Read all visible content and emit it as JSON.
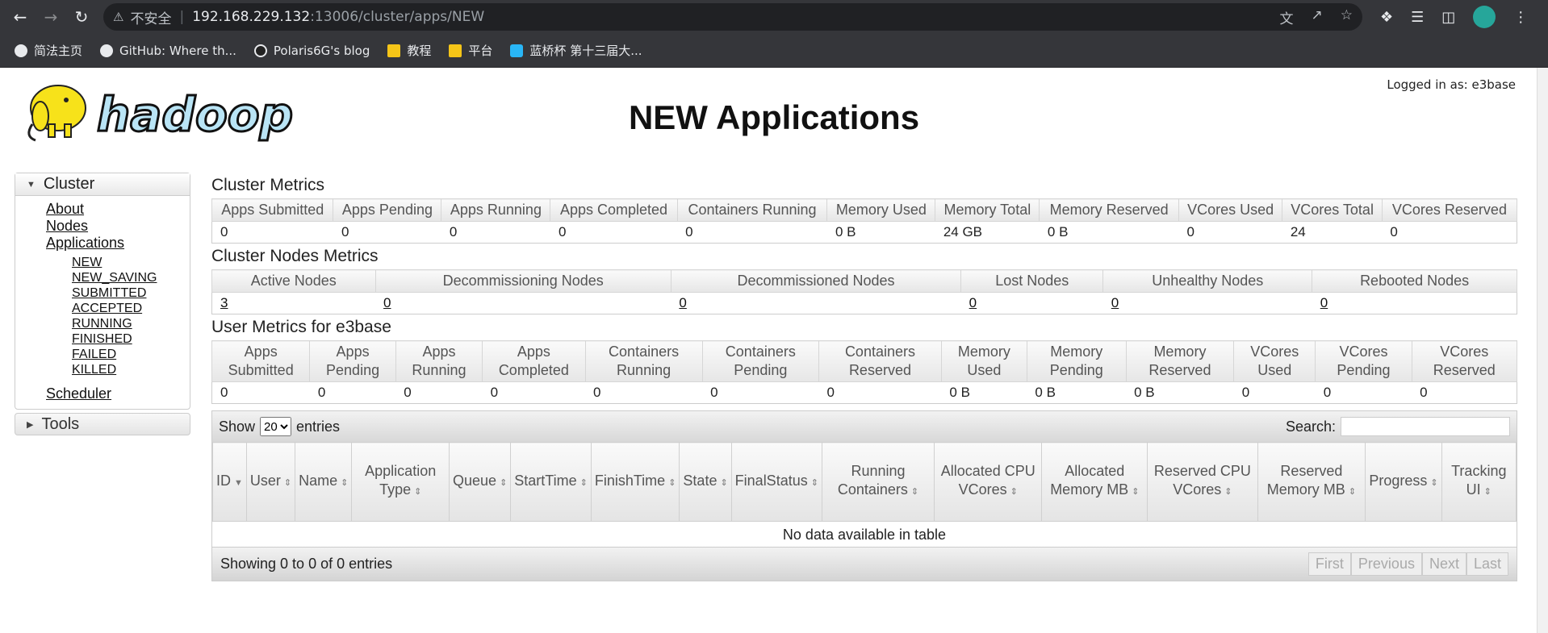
{
  "browser": {
    "security_label": "不安全",
    "url_host": "192.168.229.132",
    "url_path": ":13006/cluster/apps/NEW",
    "bookmarks": [
      {
        "label": "简法主页",
        "icon": "circle-icon"
      },
      {
        "label": "GitHub: Where th...",
        "icon": "github-icon"
      },
      {
        "label": "Polaris6G's blog",
        "icon": "blog-icon"
      },
      {
        "label": "教程",
        "icon": "folder-icon"
      },
      {
        "label": "平台",
        "icon": "folder-icon"
      },
      {
        "label": "蓝桥杯 第十三届大...",
        "icon": "lanqiao-icon"
      }
    ]
  },
  "header": {
    "title": "NEW Applications",
    "logged_in": "Logged in as: e3base",
    "logo_text": "hadoop"
  },
  "sidebar": {
    "cluster_label": "Cluster",
    "links": [
      "About",
      "Nodes",
      "Applications"
    ],
    "app_states": [
      "NEW",
      "NEW_SAVING",
      "SUBMITTED",
      "ACCEPTED",
      "RUNNING",
      "FINISHED",
      "FAILED",
      "KILLED"
    ],
    "scheduler": "Scheduler",
    "tools_label": "Tools"
  },
  "cluster_metrics": {
    "title": "Cluster Metrics",
    "headers": [
      "Apps Submitted",
      "Apps Pending",
      "Apps Running",
      "Apps Completed",
      "Containers Running",
      "Memory Used",
      "Memory Total",
      "Memory Reserved",
      "VCores Used",
      "VCores Total",
      "VCores Reserved"
    ],
    "values": [
      "0",
      "0",
      "0",
      "0",
      "0",
      "0 B",
      "24 GB",
      "0 B",
      "0",
      "24",
      "0"
    ]
  },
  "node_metrics": {
    "title": "Cluster Nodes Metrics",
    "headers": [
      "Active Nodes",
      "Decommissioning Nodes",
      "Decommissioned Nodes",
      "Lost Nodes",
      "Unhealthy Nodes",
      "Rebooted Nodes"
    ],
    "values": [
      "3",
      "0",
      "0",
      "0",
      "0",
      "0"
    ]
  },
  "user_metrics": {
    "title": "User Metrics for e3base",
    "headers": [
      "Apps Submitted",
      "Apps Pending",
      "Apps Running",
      "Apps Completed",
      "Containers Running",
      "Containers Pending",
      "Containers Reserved",
      "Memory Used",
      "Memory Pending",
      "Memory Reserved",
      "VCores Used",
      "VCores Pending",
      "VCores Reserved"
    ],
    "values": [
      "0",
      "0",
      "0",
      "0",
      "0",
      "0",
      "0",
      "0 B",
      "0 B",
      "0 B",
      "0",
      "0",
      "0"
    ]
  },
  "apps_table": {
    "show_label": "Show",
    "entries_label": "entries",
    "page_size": "20",
    "search_label": "Search:",
    "columns": [
      "ID",
      "User",
      "Name",
      "Application Type",
      "Queue",
      "StartTime",
      "FinishTime",
      "State",
      "FinalStatus",
      "Running Containers",
      "Allocated CPU VCores",
      "Allocated Memory MB",
      "Reserved CPU VCores",
      "Reserved Memory MB",
      "Progress",
      "Tracking UI"
    ],
    "empty_message": "No data available in table",
    "info": "Showing 0 to 0 of 0 entries",
    "pager": [
      "First",
      "Previous",
      "Next",
      "Last"
    ]
  }
}
